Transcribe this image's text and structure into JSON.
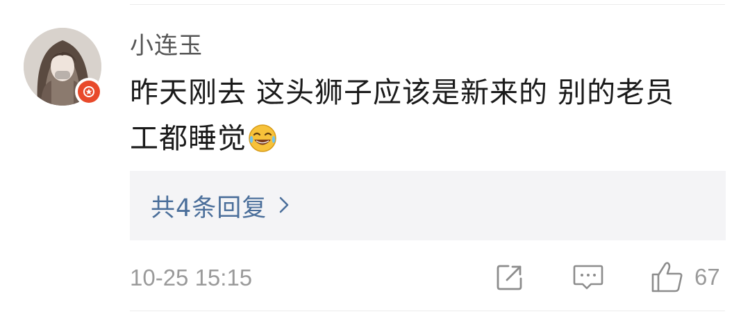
{
  "comment": {
    "username": "小连玉",
    "text_line1": "昨天刚去 这头狮子应该是新来的 别的老员",
    "text_line2": "工都睡觉",
    "emoji": "laughing-crying-emoji",
    "replies_label": "共4条回复",
    "timestamp": "10-25 15:15",
    "like_count": "67",
    "verified": true
  },
  "colors": {
    "link": "#4a6e9a",
    "muted": "#9a9a9a",
    "badge": "#e84a2b",
    "reply_bg": "#f4f4f6"
  },
  "icons": {
    "share": "share-icon",
    "reply": "comment-icon",
    "like": "thumbs-up-icon",
    "replies_arrow": "chevron-right-icon",
    "badge": "verified-star-icon"
  }
}
